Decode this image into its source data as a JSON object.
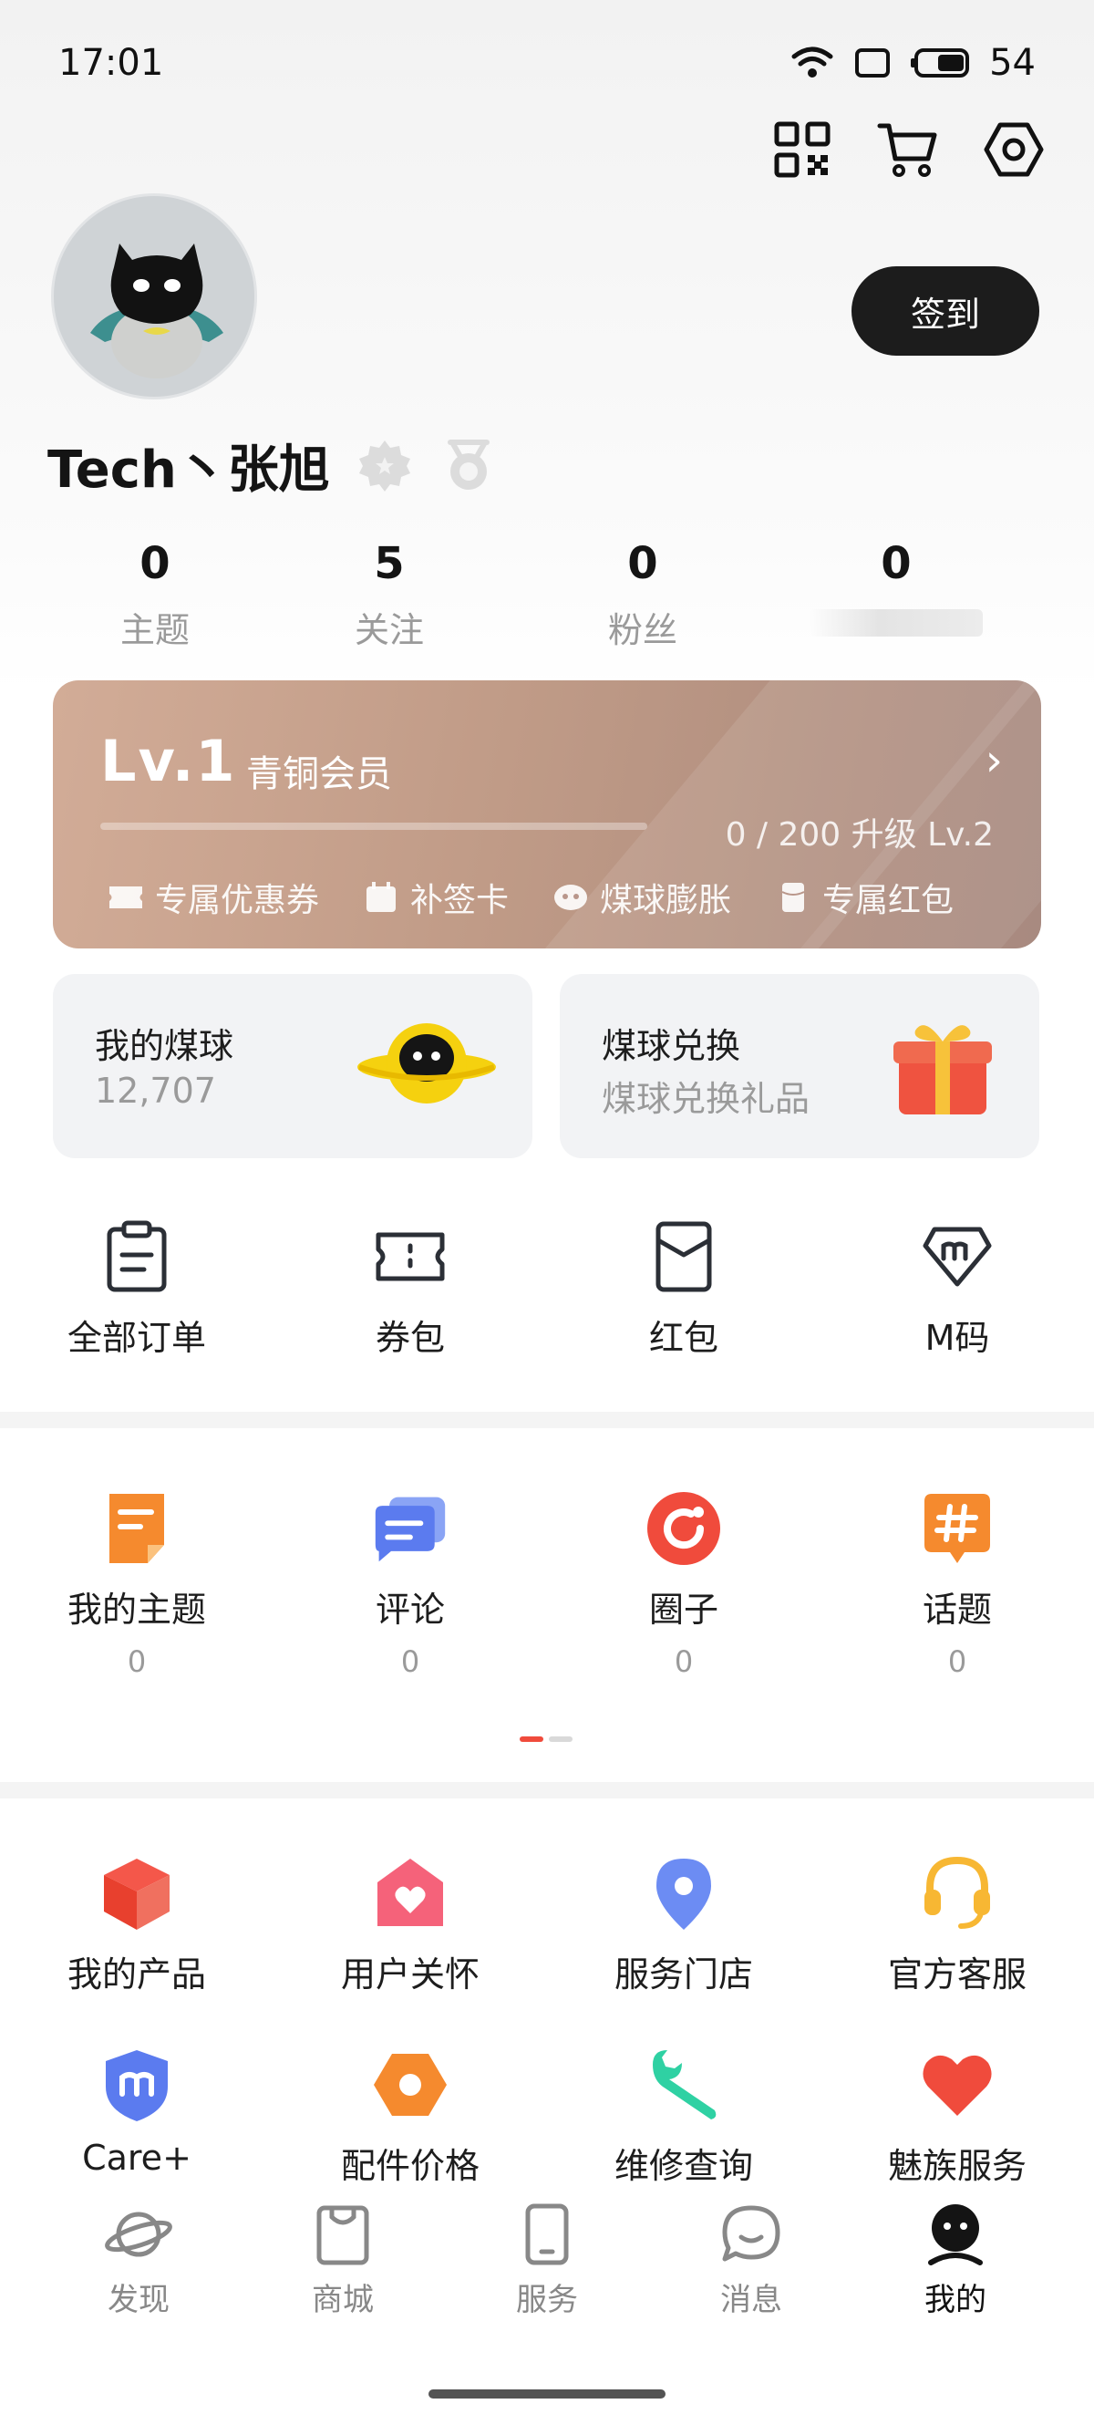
{
  "status_bar": {
    "time": "17:01",
    "battery": "54"
  },
  "profile": {
    "username": "Tech丶张旭",
    "checkin_label": "签到"
  },
  "stats": [
    {
      "value": "0",
      "label": "主题"
    },
    {
      "value": "5",
      "label": "关注"
    },
    {
      "value": "0",
      "label": "粉丝"
    },
    {
      "value": "0",
      "label": ""
    }
  ],
  "level_card": {
    "level": "Lv.1",
    "name": "青铜会员",
    "progress_text": "0 / 200 升级 Lv.2",
    "progress_fraction": 0,
    "perks": [
      "专属优惠券",
      "补签卡",
      "煤球膨胀",
      "专属红包"
    ]
  },
  "coin_cards": {
    "my_coins": {
      "title": "我的煤球",
      "value": "12,707"
    },
    "exchange": {
      "title": "煤球兑换",
      "subtitle": "煤球兑换礼品"
    }
  },
  "orders": [
    {
      "label": "全部订单",
      "icon": "clipboard-icon"
    },
    {
      "label": "券包",
      "icon": "ticket-icon"
    },
    {
      "label": "红包",
      "icon": "red-packet-icon"
    },
    {
      "label": "M码",
      "icon": "m-code-icon"
    }
  ],
  "community": [
    {
      "label": "我的主题",
      "count": "0",
      "icon": "note-icon"
    },
    {
      "label": "评论",
      "count": "0",
      "icon": "comment-icon"
    },
    {
      "label": "圈子",
      "count": "0",
      "icon": "circle-icon"
    },
    {
      "label": "话题",
      "count": "0",
      "icon": "hashtag-icon"
    }
  ],
  "services_row1": [
    {
      "label": "我的产品",
      "icon": "cube-icon"
    },
    {
      "label": "用户关怀",
      "icon": "heart-house-icon"
    },
    {
      "label": "服务门店",
      "icon": "location-icon"
    },
    {
      "label": "官方客服",
      "icon": "headset-icon"
    }
  ],
  "services_row2": [
    {
      "label": "Care+",
      "icon": "shield-m-icon"
    },
    {
      "label": "配件价格",
      "icon": "hex-nut-icon"
    },
    {
      "label": "维修查询",
      "icon": "wrench-icon"
    },
    {
      "label": "魅族服务",
      "icon": "heart-icon"
    }
  ],
  "bottom_nav": [
    {
      "label": "发现",
      "icon": "planet-icon"
    },
    {
      "label": "商城",
      "icon": "shopping-bag-icon"
    },
    {
      "label": "服务",
      "icon": "phone-icon"
    },
    {
      "label": "消息",
      "icon": "chat-icon"
    },
    {
      "label": "我的",
      "icon": "profile-icon",
      "active": true
    }
  ],
  "colors": {
    "accent_red": "#f04b3c",
    "level_card": "#c09b87",
    "checkin_bg": "#1c1c1c"
  }
}
